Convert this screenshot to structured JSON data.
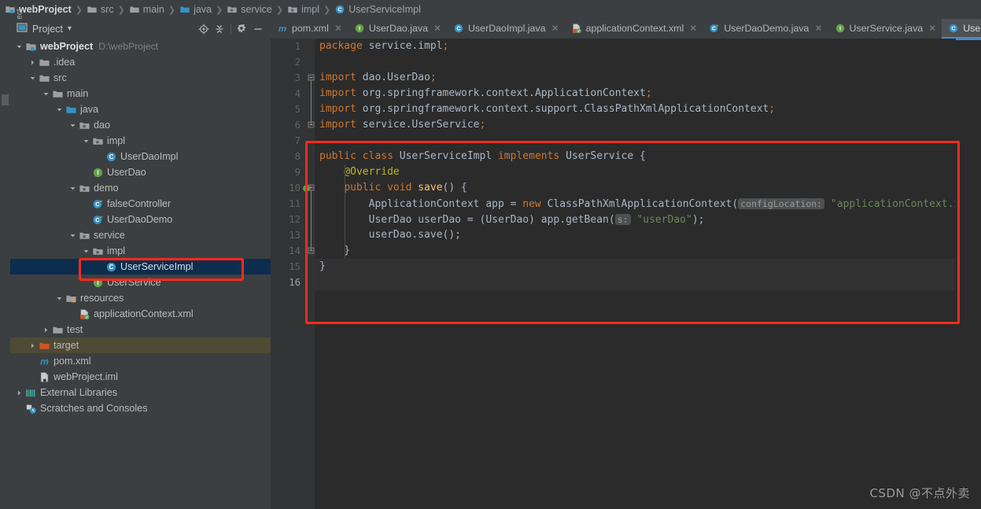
{
  "breadcrumb": {
    "items": [
      {
        "label": "webProject",
        "icon": "module-icon",
        "root": true
      },
      {
        "label": "src",
        "icon": "folder-icon"
      },
      {
        "label": "main",
        "icon": "folder-icon"
      },
      {
        "label": "java",
        "icon": "source-folder-icon"
      },
      {
        "label": "service",
        "icon": "package-icon"
      },
      {
        "label": "impl",
        "icon": "package-icon"
      },
      {
        "label": "UserServiceImpl",
        "icon": "class-icon"
      }
    ],
    "separator": "❯"
  },
  "tool_strip": {
    "project_label": "1: Project"
  },
  "project_panel": {
    "title": "Project",
    "dropdown_caret": "▾",
    "actions": [
      {
        "name": "locate-icon",
        "glyph": "⊕"
      },
      {
        "name": "collapse-all-icon",
        "glyph": "≡"
      },
      {
        "name": "settings-gear-icon",
        "glyph": "⚙"
      },
      {
        "name": "hide-icon",
        "glyph": "—"
      }
    ],
    "tree": [
      {
        "label": "webProject",
        "sub": "D:\\webProject",
        "depth": 0,
        "arrow": "down",
        "icon": "module-icon",
        "root": true
      },
      {
        "label": ".idea",
        "depth": 1,
        "arrow": "right",
        "icon": "folder-icon"
      },
      {
        "label": "src",
        "depth": 1,
        "arrow": "down",
        "icon": "folder-icon"
      },
      {
        "label": "main",
        "depth": 2,
        "arrow": "down",
        "icon": "folder-icon"
      },
      {
        "label": "java",
        "depth": 3,
        "arrow": "down",
        "icon": "source-folder-icon"
      },
      {
        "label": "dao",
        "depth": 4,
        "arrow": "down",
        "icon": "package-icon"
      },
      {
        "label": "impl",
        "depth": 5,
        "arrow": "down",
        "icon": "package-icon"
      },
      {
        "label": "UserDaoImpl",
        "depth": 6,
        "arrow": "none",
        "icon": "class-icon"
      },
      {
        "label": "UserDao",
        "depth": 5,
        "arrow": "none",
        "icon": "interface-icon"
      },
      {
        "label": "demo",
        "depth": 4,
        "arrow": "down",
        "icon": "package-icon"
      },
      {
        "label": "falseController",
        "depth": 5,
        "arrow": "none",
        "icon": "runnable-class-icon"
      },
      {
        "label": "UserDaoDemo",
        "depth": 5,
        "arrow": "none",
        "icon": "runnable-class-icon"
      },
      {
        "label": "service",
        "depth": 4,
        "arrow": "down",
        "icon": "package-icon"
      },
      {
        "label": "impl",
        "depth": 5,
        "arrow": "down",
        "icon": "package-icon"
      },
      {
        "label": "UserServiceImpl",
        "depth": 6,
        "arrow": "none",
        "icon": "class-icon",
        "selected": true
      },
      {
        "label": "UserService",
        "depth": 5,
        "arrow": "none",
        "icon": "interface-icon"
      },
      {
        "label": "resources",
        "depth": 3,
        "arrow": "down",
        "icon": "resources-folder-icon"
      },
      {
        "label": "applicationContext.xml",
        "depth": 4,
        "arrow": "none",
        "icon": "spring-xml-icon"
      },
      {
        "label": "test",
        "depth": 2,
        "arrow": "right",
        "icon": "folder-icon"
      },
      {
        "label": "target",
        "depth": 1,
        "arrow": "right",
        "icon": "excluded-folder-icon",
        "highlight": true
      },
      {
        "label": "pom.xml",
        "depth": 1,
        "arrow": "none",
        "icon": "maven-icon"
      },
      {
        "label": "webProject.iml",
        "depth": 1,
        "arrow": "none",
        "icon": "iml-icon"
      },
      {
        "label": "External Libraries",
        "depth": 0,
        "arrow": "right",
        "icon": "libraries-icon"
      },
      {
        "label": "Scratches and Consoles",
        "depth": 0,
        "arrow": "none",
        "icon": "scratches-icon"
      }
    ]
  },
  "editor": {
    "tabs": [
      {
        "label": "pom.xml",
        "icon": "maven-icon",
        "active": false,
        "close": "✕"
      },
      {
        "label": "UserDao.java",
        "icon": "interface-icon",
        "active": false,
        "close": "✕"
      },
      {
        "label": "UserDaoImpl.java",
        "icon": "class-icon",
        "active": false,
        "close": "✕"
      },
      {
        "label": "applicationContext.xml",
        "icon": "spring-xml-icon",
        "active": false,
        "close": "✕"
      },
      {
        "label": "UserDaoDemo.java",
        "icon": "runnable-class-icon",
        "active": false,
        "close": "✕"
      },
      {
        "label": "UserService.java",
        "icon": "interface-icon",
        "active": false,
        "close": "✕"
      },
      {
        "label": "UserServiceImpl.java",
        "icon": "class-icon",
        "active": true,
        "close": "✕"
      }
    ],
    "line_numbers": [
      "1",
      "2",
      "3",
      "4",
      "5",
      "6",
      "7",
      "8",
      "9",
      "10",
      "11",
      "12",
      "13",
      "14",
      "15",
      "16"
    ],
    "current_line": 16,
    "gutter_icons": [
      {
        "line": 10,
        "name": "implementing-method-icon"
      }
    ],
    "fold_marks": [
      {
        "line": 3,
        "name": "fold-imports-icon"
      },
      {
        "line": 6,
        "name": "fold-imports-end-icon"
      },
      {
        "line": 10,
        "name": "fold-method-icon"
      },
      {
        "line": 14,
        "name": "fold-method-end-icon"
      }
    ],
    "code": [
      {
        "n": 1,
        "tokens": [
          {
            "t": "package ",
            "c": "k"
          },
          {
            "t": "service.impl",
            "c": "id"
          },
          {
            "t": ";",
            "c": "semi"
          }
        ]
      },
      {
        "n": 2,
        "tokens": []
      },
      {
        "n": 3,
        "tokens": [
          {
            "t": "import ",
            "c": "k"
          },
          {
            "t": "dao.UserDao",
            "c": "id"
          },
          {
            "t": ";",
            "c": "semi"
          }
        ]
      },
      {
        "n": 4,
        "tokens": [
          {
            "t": "import ",
            "c": "k"
          },
          {
            "t": "org.springframework.context.ApplicationContext",
            "c": "id"
          },
          {
            "t": ";",
            "c": "semi"
          }
        ]
      },
      {
        "n": 5,
        "tokens": [
          {
            "t": "import ",
            "c": "k"
          },
          {
            "t": "org.springframework.context.support.ClassPathXmlApplicationContext",
            "c": "id"
          },
          {
            "t": ";",
            "c": "semi"
          }
        ]
      },
      {
        "n": 6,
        "tokens": [
          {
            "t": "import ",
            "c": "k"
          },
          {
            "t": "service.UserService",
            "c": "id"
          },
          {
            "t": ";",
            "c": "semi"
          }
        ]
      },
      {
        "n": 7,
        "tokens": []
      },
      {
        "n": 8,
        "tokens": [
          {
            "t": "public class ",
            "c": "k"
          },
          {
            "t": "UserServiceImpl ",
            "c": "id"
          },
          {
            "t": "implements ",
            "c": "k"
          },
          {
            "t": "UserService {",
            "c": "id"
          }
        ]
      },
      {
        "n": 9,
        "tokens": [
          {
            "t": "    ",
            "c": "pun"
          },
          {
            "t": "@Override",
            "c": "ann"
          }
        ]
      },
      {
        "n": 10,
        "tokens": [
          {
            "t": "    ",
            "c": "pun"
          },
          {
            "t": "public void ",
            "c": "k"
          },
          {
            "t": "save",
            "c": "mth"
          },
          {
            "t": "() {",
            "c": "pun"
          }
        ]
      },
      {
        "n": 11,
        "tokens": [
          {
            "t": "        ApplicationContext app = ",
            "c": "id"
          },
          {
            "t": "new ",
            "c": "k"
          },
          {
            "t": "ClassPathXmlApplicationContext(",
            "c": "id"
          },
          {
            "t": "configLocation:",
            "c": "hint"
          },
          {
            "t": " ",
            "c": "pun"
          },
          {
            "t": "\"applicationContext.xml\"",
            "c": "str"
          },
          {
            "t": ");",
            "c": "pun"
          }
        ]
      },
      {
        "n": 12,
        "tokens": [
          {
            "t": "        UserDao userDao = (UserDao) app.getBean(",
            "c": "id"
          },
          {
            "t": "s:",
            "c": "hint"
          },
          {
            "t": " ",
            "c": "pun"
          },
          {
            "t": "\"userDao\"",
            "c": "str"
          },
          {
            "t": ");",
            "c": "pun"
          }
        ]
      },
      {
        "n": 13,
        "tokens": [
          {
            "t": "        userDao.save();",
            "c": "id"
          }
        ]
      },
      {
        "n": 14,
        "tokens": [
          {
            "t": "    }",
            "c": "pun"
          }
        ]
      },
      {
        "n": 15,
        "tokens": [
          {
            "t": "}",
            "c": "pun"
          }
        ]
      },
      {
        "n": 16,
        "tokens": []
      }
    ]
  },
  "watermark": {
    "text": "CSDN @不点外卖"
  },
  "colors": {
    "accent_blue": "#4a88c7",
    "highlight_red": "#fd2b1c",
    "selection_blue": "#0d2d4e",
    "editor_bg": "#2b2b2b",
    "panel_bg": "#3c3f41",
    "keyword_orange": "#cc7832",
    "string_green": "#6a8759",
    "annotation_yellow": "#bbb529",
    "method_yellow": "#ffc66d",
    "text_gray": "#a9b7c6"
  }
}
